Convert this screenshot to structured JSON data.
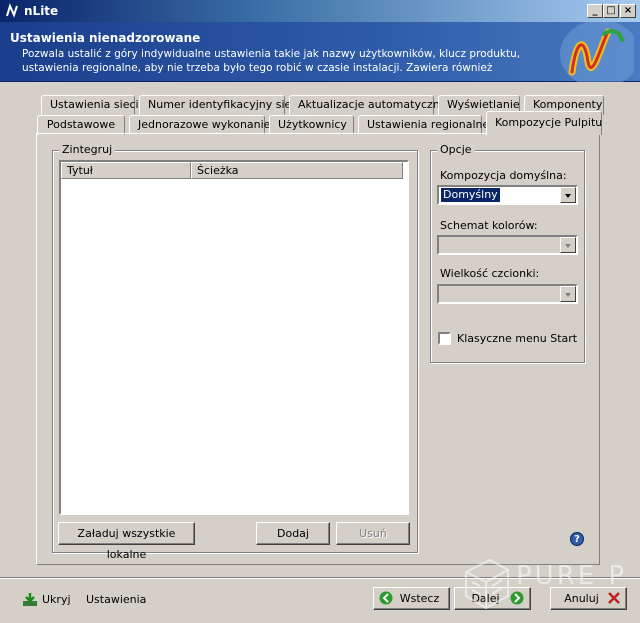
{
  "window": {
    "title": "nLite"
  },
  "banner": {
    "title": "Ustawienia nienadzorowane",
    "description": "Pozwala ustalić z góry indywidualne ustawienia takie jak nazwy użytkowników, klucz produktu, ustawienia regionalne, aby nie trzeba było tego robić w czasie instalacji. Zawiera również"
  },
  "tabs": {
    "row1": [
      "Ustawienia sieci",
      "Numer identyfikacyjny sieci",
      "Aktualizacje automatyczne",
      "Wyświetlanie",
      "Komponenty"
    ],
    "row2": [
      "Podstawowe",
      "Jednorazowe wykonanie",
      "Użytkownicy",
      "Ustawienia regionalne",
      "Kompozycje Pulpitu"
    ],
    "active": "Kompozycje Pulpitu"
  },
  "integrate": {
    "group_label": "Zintegruj",
    "columns": [
      "Tytuł",
      "Ścieżka"
    ],
    "rows": [],
    "load_all_label": "Załaduj wszystkie lokalne",
    "add_label": "Dodaj",
    "remove_label": "Usuń"
  },
  "options": {
    "group_label": "Opcje",
    "default_theme_label": "Kompozycja domyślna:",
    "default_theme_value": "Domyślny",
    "color_scheme_label": "Schemat kolorów:",
    "font_size_label": "Wielkość czcionki:",
    "classic_start_label": "Klasyczne menu Start",
    "classic_start_checked": false
  },
  "footer": {
    "hide_label": "Ukryj",
    "settings_label": "Ustawienia",
    "back_label": "Wstecz",
    "next_label": "Dalej",
    "cancel_label": "Anuluj"
  },
  "watermark": {
    "text": "PURE PC"
  },
  "colors": {
    "titlebar": "#0a246a",
    "banner": "#2f5ca8",
    "face": "#d4d0c8",
    "selection": "#0a246a"
  }
}
